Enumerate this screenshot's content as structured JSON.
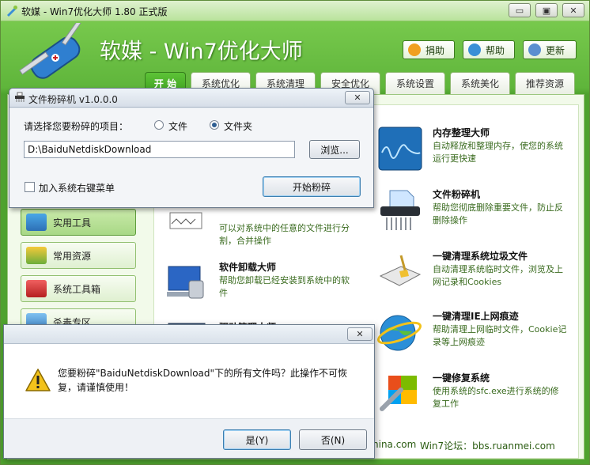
{
  "main_window": {
    "title": "软媒 - Win7优化大师 1.80 正式版",
    "app_title": "软媒 - Win7优化大师",
    "window_controls": {
      "minimize": "▭",
      "maximize": "▣",
      "close": "✕"
    },
    "top_buttons": [
      {
        "label": "捐助",
        "icon": "donate-icon"
      },
      {
        "label": "帮助",
        "icon": "help-icon"
      },
      {
        "label": "更新",
        "icon": "update-icon"
      }
    ],
    "tabs": [
      "开 始",
      "系统优化",
      "系统清理",
      "安全优化",
      "系统设置",
      "系统美化",
      "推荐资源"
    ],
    "active_tab": "开 始",
    "sidebar": [
      {
        "label": "实用工具",
        "selected": true
      },
      {
        "label": "常用资源",
        "selected": false
      },
      {
        "label": "系统工具箱",
        "selected": false
      },
      {
        "label": "杀毒专区",
        "selected": false
      }
    ],
    "tools_left": [
      {
        "name": "",
        "desc": "可以对系统中的任意的文件进行分割，合并操作"
      },
      {
        "name": "软件卸载大师",
        "desc": "帮助您卸载已经安装到系统中的软件"
      },
      {
        "name": "驱动管理大师",
        "desc": ""
      }
    ],
    "tools_right": [
      {
        "name": "内存整理大师",
        "desc": "自动释放和整理内存，使您的系统运行更快速"
      },
      {
        "name": "文件粉碎机",
        "desc": "帮助您彻底删除重要文件，防止反删除操作"
      },
      {
        "name": "一键清理系统垃圾文件",
        "desc": "自动清理系统临时文件，浏览及上网记录和Cookies"
      },
      {
        "name": "一键清理IE上网痕迹",
        "desc": "帮助清理上网临时文件，Cookie记录等上网痕迹"
      },
      {
        "name": "一键修复系统",
        "desc": "使用系统的sfc.exe进行系统的修复工作"
      }
    ],
    "footer": {
      "site": "hina.com",
      "forum": "Win7论坛：bbs.ruanmei.com"
    }
  },
  "shredder_dialog": {
    "title": "文件粉碎机 v1.0.0.0",
    "close": "✕",
    "prompt": "请选择您要粉碎的项目：",
    "option_file": "文件",
    "option_folder": "文件夹",
    "selected_option": "文件夹",
    "path_value": "D:\\BaiduNetdiskDownload",
    "browse_label": "浏览...",
    "context_menu_label": "加入系统右键菜单",
    "context_menu_checked": false,
    "start_label": "开始粉碎"
  },
  "confirm_dialog": {
    "close": "✕",
    "message": "您要粉碎\"BaiduNetdiskDownload\"下的所有文件吗？此操作不可恢复，请谨慎使用！",
    "yes_label": "是(Y)",
    "no_label": "否(N)"
  },
  "colors": {
    "brand_green": "#5fb53b",
    "tab_active": "#4cae2a",
    "desc_text": "#3a6b1f",
    "warning": "#f2c21b"
  }
}
